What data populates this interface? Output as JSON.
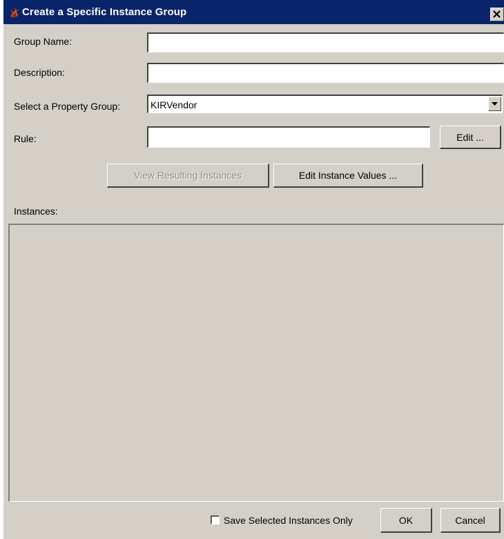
{
  "window": {
    "title": "Create a Specific Instance Group"
  },
  "form": {
    "group_name_label": "Group Name:",
    "group_name_value": "",
    "description_label": "Description:",
    "description_value": "",
    "property_group_label": "Select a Property Group:",
    "property_group_selected": "KIRVendor",
    "rule_label": "Rule:",
    "rule_value": "",
    "edit_rule_label": "Edit ..."
  },
  "actions": {
    "view_resulting_label": "View Resulting Instances",
    "view_resulting_enabled": false,
    "edit_instance_values_label": "Edit Instance Values ..."
  },
  "instances": {
    "label": "Instances:",
    "items": []
  },
  "footer": {
    "save_selected_label": "Save Selected Instances Only",
    "save_selected_checked": false,
    "ok_label": "OK",
    "cancel_label": "Cancel"
  },
  "icons": {
    "window": "app-icon",
    "close": "close-icon",
    "dropdown": "chevron-down-icon"
  },
  "colors": {
    "titlebar": "#0a246a",
    "dialog_bg": "#d4d0c8",
    "disabled_text": "#8c8c8c"
  }
}
